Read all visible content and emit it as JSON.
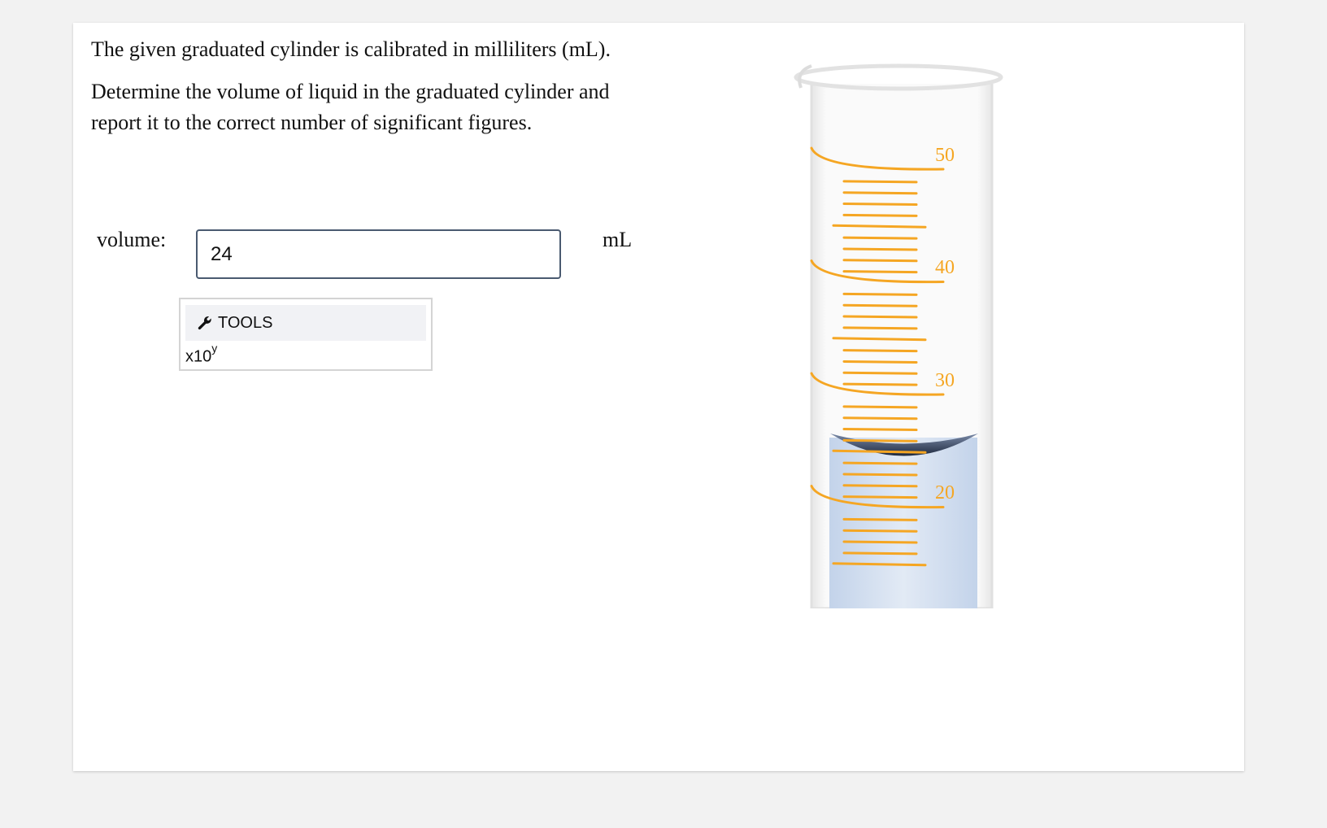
{
  "question": {
    "line1": "The given graduated cylinder is calibrated in milliliters (mL).",
    "line2": "Determine the volume of liquid in the graduated cylinder and report it to the correct number of significant figures."
  },
  "answer": {
    "label": "volume:",
    "value": "24",
    "unit": "mL"
  },
  "tools": {
    "header_label": "TOOLS",
    "icon": "wrench-icon",
    "exponent_base": "x10",
    "exponent_sup": "y"
  },
  "cylinder": {
    "scale_labels": [
      "50",
      "40",
      "30",
      "20"
    ],
    "scale_color": "#f5a623",
    "liquid_color": "#c9d8ec",
    "liquid_level_ml": 24
  }
}
